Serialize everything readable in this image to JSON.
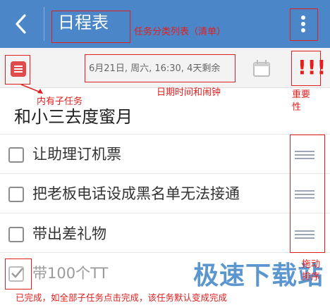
{
  "header": {
    "title": "日程表",
    "bg_color": "#4a86c8"
  },
  "toolbar": {
    "datetime": "6月21日, 周六, 16:30, 4天剩余",
    "priority": "!!!"
  },
  "task": {
    "title": "和小三去度蜜月"
  },
  "subtasks": [
    {
      "label": "让助理订机票",
      "done": false
    },
    {
      "label": "把老板电话设成黑名单无法接通",
      "done": false
    },
    {
      "label": "带出差礼物",
      "done": false
    },
    {
      "label": "带100个TT",
      "done": true
    }
  ],
  "annotations": {
    "category": "任务分类列表（清单）",
    "has_subtasks": "内有子任务",
    "datetime_alarm": "日期时间和闹钟",
    "importance_1": "重要",
    "importance_2": "性",
    "drag_sort_1": "拖动",
    "drag_sort_2": "排序",
    "completed": "已完成，如全部子任务点击完成，该任务默认变成完成",
    "color": "#e02020"
  },
  "watermark": "极速下载站"
}
